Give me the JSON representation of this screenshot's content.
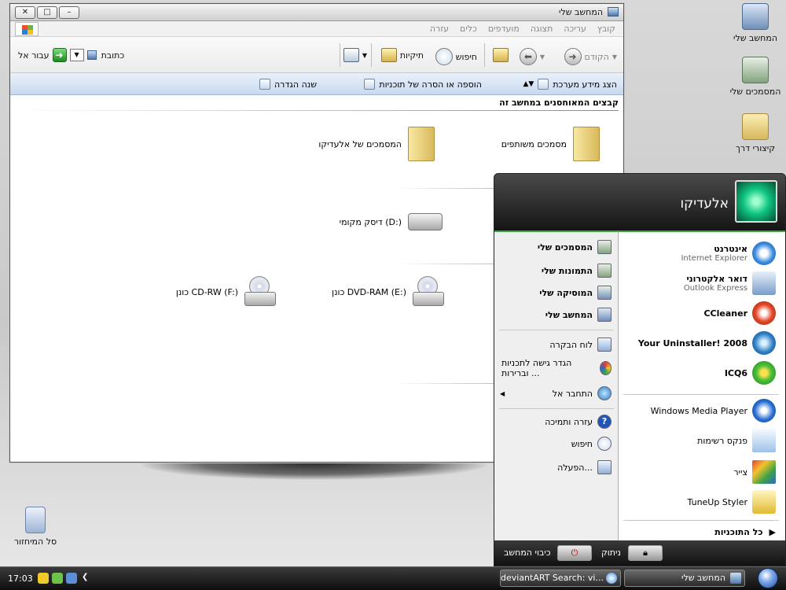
{
  "desktop": {
    "icons": [
      {
        "label": "המחשב שלי",
        "icon": "computer-icon"
      },
      {
        "label": "המסמכים שלי",
        "icon": "documents-icon"
      },
      {
        "label": "קיצורי דרך",
        "icon": "folder-icon"
      },
      {
        "label": "סל המיחזור",
        "icon": "recycle-bin-icon"
      }
    ]
  },
  "window": {
    "title": "המחשב שלי",
    "menus": [
      "קובץ",
      "עריכה",
      "תצוגה",
      "מועדפים",
      "כלים",
      "עזרה"
    ],
    "toolbar": {
      "back": "הקודם",
      "search": "חיפוש",
      "folders": "תיקיות",
      "address_label": "כתובת",
      "go": "עבור אל"
    },
    "tasks": {
      "system_info": "הצג מידע מערכת",
      "add_remove": "הוספה או הסרה של תוכניות",
      "change_setting": "שנה הגדרה"
    },
    "group_header": "קבצים המאוחסנים במחשב זה",
    "items": {
      "shared_docs": "מסמכים משותפים",
      "user_docs": "המסמכים של אלעדיקו",
      "local_disk": "דיסק מקומי (D:)",
      "dvd_ram": "כונן DVD-RAM (E:)",
      "cd_rw": "כונן CD-RW (F:)"
    }
  },
  "start_menu": {
    "user": "אלעדיקו",
    "pinned": [
      {
        "name": "אינטרנט",
        "sub": "Internet Explorer",
        "icon": "ie-icon"
      },
      {
        "name": "דואר אלקטרוני",
        "sub": "Outlook Express",
        "icon": "mail-icon"
      },
      {
        "name": "CCleaner",
        "icon": "ccleaner-icon"
      },
      {
        "name": "Your Uninstaller! 2008",
        "icon": "uninstaller-icon"
      },
      {
        "name": "ICQ6",
        "icon": "icq-icon"
      }
    ],
    "recent": [
      {
        "name": "Windows Media Player",
        "icon": "media-player-icon"
      },
      {
        "name": "פנקס רשימות",
        "icon": "notepad-icon"
      },
      {
        "name": "צייר",
        "icon": "paint-icon"
      },
      {
        "name": "TuneUp Styler",
        "icon": "tuneup-icon"
      }
    ],
    "all_programs": "כל התוכניות",
    "places": [
      {
        "name": "המסמכים שלי",
        "bold": true
      },
      {
        "name": "התמונות שלי",
        "bold": true
      },
      {
        "name": "המוסיקה שלי",
        "bold": true
      },
      {
        "name": "המחשב שלי",
        "bold": true
      },
      {
        "name": "לוח הבקרה",
        "bold": false
      },
      {
        "name": "הגדר גישה לתכניות וברירות ...",
        "bold": false
      },
      {
        "name": "התחבר אל",
        "bold": false
      },
      {
        "name": "עזרה ותמיכה",
        "bold": false
      },
      {
        "name": "חיפוש",
        "bold": false
      },
      {
        "name": "הפעלה...",
        "bold": false
      }
    ],
    "logoff": "ניתוק",
    "shutdown": "כיבוי המחשב"
  },
  "taskbar": {
    "tasks": [
      "המחשב שלי",
      "deviantART Search: vi..."
    ],
    "clock": "17:03"
  },
  "colors": {
    "accent_green": "#3ba63b",
    "taskbar": "#1a1a1a"
  }
}
